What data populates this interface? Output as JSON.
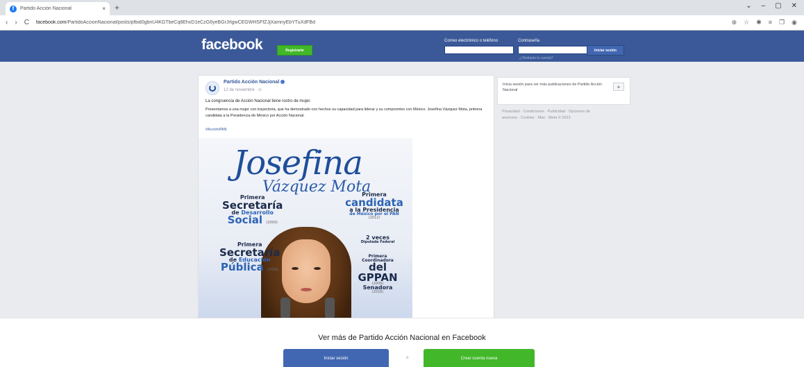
{
  "browser": {
    "tab_title": "Partido Acción Nacional",
    "tab_close": "×",
    "new_tab": "+",
    "nav_back": "‹",
    "nav_forward": "›",
    "nav_reload": "C",
    "url_host": "facebook.com",
    "url_path": "/PartidoAccionNacional/posts/pfbid0gbnU4KGTbeCq8EhxD1eCzG6yeBGrJrtgwCEGWHSFfZJjXamnyEbYTuXdFBd",
    "window_controls": [
      "⌄",
      "–",
      "▢",
      "✕"
    ],
    "ext_icons": [
      "⊕",
      "☆",
      "✱",
      "≡",
      "❐",
      "◉"
    ]
  },
  "header": {
    "logo": "facebook",
    "register_label": "Registrarte",
    "email_label": "Correo electrónico o teléfono",
    "password_label": "Contraseña",
    "login_label": "Iniciar sesión",
    "forgot_label": "¿Olvidaste tu cuenta?"
  },
  "post": {
    "page_name": "Partido Acción Nacional",
    "date": "12 de noviembre · ⊙",
    "heading": "La congruencia de Acción Nacional tiene rostro de mujer.",
    "body": "Presentamos a una mujer con trayectoria, que ha demostrado con hechos su capacidad para liderar y su compromiso con México. Josefina Vázquez Mota, primera candidata a la Presidencia de México por Acción Nacional.",
    "hashtag": "#AcciónPAN",
    "image": {
      "name_script": "Josefina",
      "surname_script": "Vázquez Mota",
      "left_1": {
        "l1": "Primera",
        "l2": "Secretaría",
        "l3a": "de",
        "l3b": "Desarrollo",
        "l4": "Social",
        "year": "(2000)"
      },
      "left_2": {
        "l1": "Primera",
        "l2": "Secretaría",
        "l3a": "de",
        "l3b": "Educación",
        "l4": "Pública",
        "year": "(2006)"
      },
      "right_1": {
        "l1": "Primera",
        "l2": "candidata",
        "l3": "a la Presidencia",
        "l4": "de México por el PAN",
        "year": "(2012)"
      },
      "right_2": {
        "l1": "2 veces",
        "l2": "Diputada Federal"
      },
      "right_3": {
        "l1": "Primera",
        "l2": "Coordinadora",
        "l3": "del GPPAN",
        "year": "(2009)"
      },
      "right_4": {
        "l1": "Senadora",
        "year": "(2018)"
      }
    }
  },
  "sidebar": {
    "card_text": "Inicia sesión para ver más publicaciones de Partido Acción Nacional",
    "plus": "+",
    "footer": "Privacidad · Condiciones · Publicidad · Opciones de anuncios · Cookies · Más · Meta © 2023"
  },
  "overlay": {
    "text": "Ver más de Partido Acción Nacional en Facebook",
    "login_label": "Iniciar sesión",
    "or_label": "o",
    "create_label": "Crear cuenta nueva"
  },
  "colors": {
    "fb_blue": "#3b5998",
    "button_blue": "#4267b2",
    "green": "#42b72a"
  }
}
